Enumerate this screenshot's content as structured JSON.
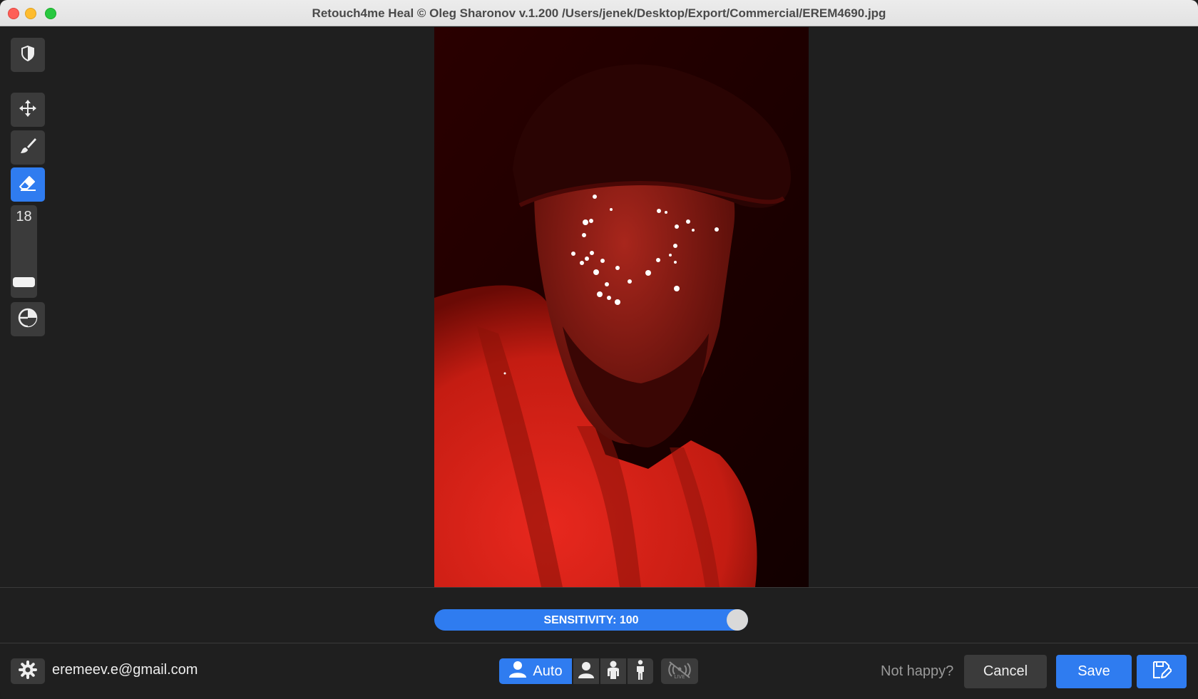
{
  "window": {
    "title": "Retouch4me Heal © Oleg Sharonov v.1.200 /Users/jenek/Desktop/Export/Commercial/EREM4690.jpg"
  },
  "toolbar": {
    "tools": [
      {
        "name": "mask-overlay-toggle",
        "icon": "shield-half-icon"
      },
      {
        "name": "move-tool",
        "icon": "move-arrows-icon"
      },
      {
        "name": "brush-tool",
        "icon": "brush-icon"
      },
      {
        "name": "eraser-tool",
        "icon": "eraser-icon",
        "active": true
      },
      {
        "name": "compare-toggle",
        "icon": "contrast-circle-icon"
      }
    ],
    "brush_size": "18",
    "brush_size_level": 0.15
  },
  "canvas": {
    "image_alt": "portrait-red-mask",
    "mask_color": "#e8281e"
  },
  "sensitivity": {
    "label": "SENSITIVITY: 100",
    "value": 100,
    "max": 100
  },
  "footer": {
    "account_email": "eremeev.e@gmail.com",
    "modes": {
      "auto_label": "Auto",
      "options": [
        "portrait-icon",
        "half-body-icon",
        "full-body-icon"
      ]
    },
    "live_icon": "live-broadcast-icon",
    "not_happy": "Not happy?",
    "cancel_label": "Cancel",
    "save_label": "Save",
    "save_as_icon": "save-as-icon"
  },
  "colors": {
    "accent": "#2f7cf0",
    "panel": "#1f1f1f",
    "button": "#3b3b3b"
  }
}
